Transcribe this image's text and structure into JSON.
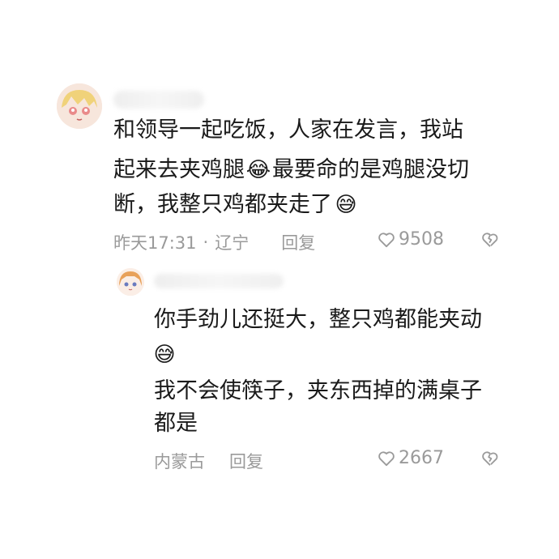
{
  "comment": {
    "lines": [
      "和领导一起吃饭，人家在发言，我站",
      "起来去夹鸡腿",
      "最要命的是鸡腿没切",
      "断，我整只鸡都夹走了"
    ],
    "emoji_1": "😂",
    "emoji_2": "😅",
    "time": "昨天17:31",
    "location": "辽宁",
    "reply_label": "回复",
    "like_count": "9508"
  },
  "reply": {
    "lines": [
      "你手劲儿还挺大，整只鸡都能夹动",
      "我不会使筷子，夹东西掉的满桌子",
      "都是"
    ],
    "emoji": "😅",
    "location": "内蒙古",
    "reply_label": "回复",
    "like_count": "2667"
  },
  "icons": {
    "like": "heart-outline-icon",
    "dislike": "broken-heart-icon",
    "icon_color": "#9a9a9a"
  }
}
